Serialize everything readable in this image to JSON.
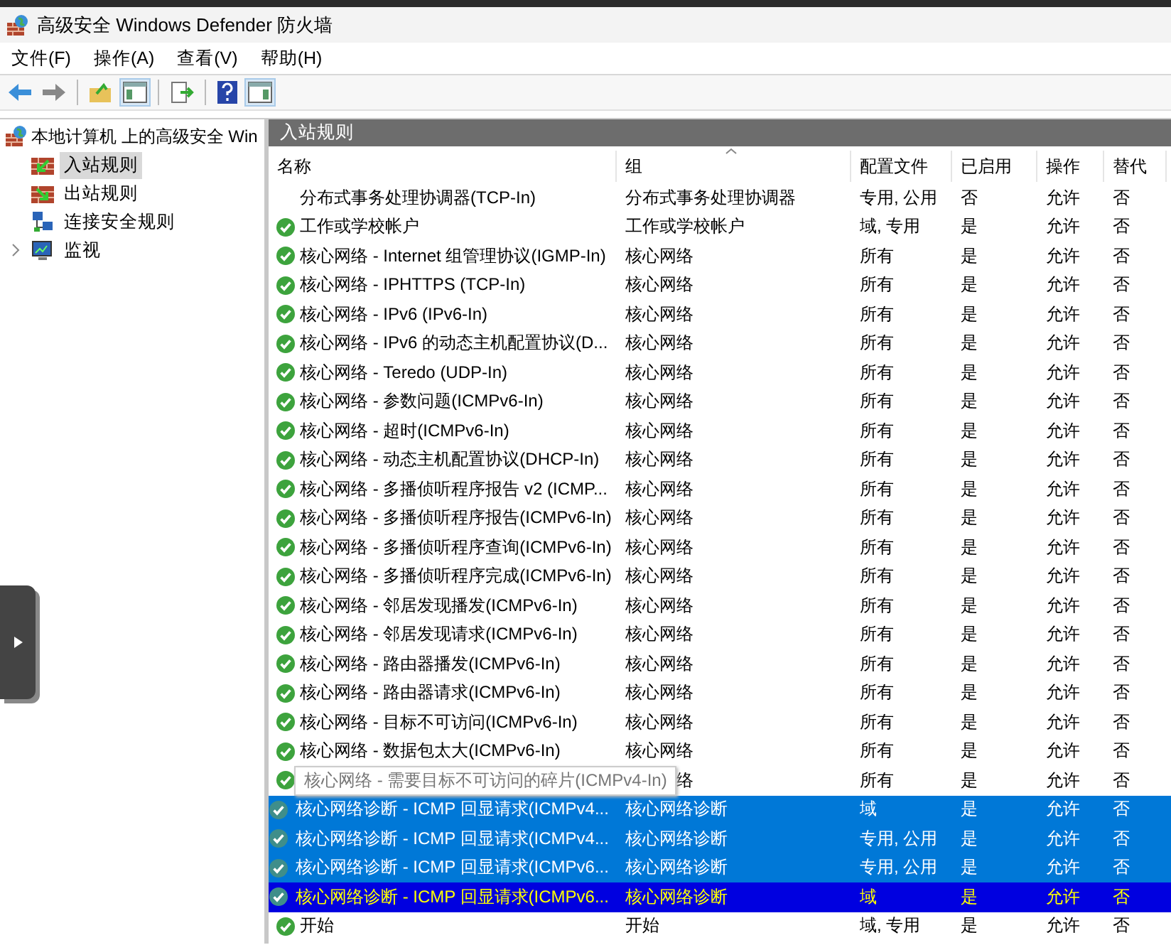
{
  "window": {
    "title": "高级安全 Windows Defender 防火墙"
  },
  "menu": [
    "文件(F)",
    "操作(A)",
    "查看(V)",
    "帮助(H)"
  ],
  "tree": {
    "root": "本地计算机 上的高级安全 Win",
    "items": [
      {
        "label": "入站规则",
        "selected": true,
        "kind": "inbound"
      },
      {
        "label": "出站规则",
        "selected": false,
        "kind": "outbound"
      },
      {
        "label": "连接安全规则",
        "selected": false,
        "kind": "connection"
      },
      {
        "label": "监视",
        "selected": false,
        "kind": "monitor",
        "expandable": true
      }
    ]
  },
  "panel": {
    "title": "入站规则"
  },
  "table": {
    "columns": [
      "名称",
      "组",
      "配置文件",
      "已启用",
      "操作",
      "替代"
    ],
    "rows": [
      {
        "name": "分布式事务处理协调器(TCP-In)",
        "group": "分布式事务处理协调器",
        "profile": "专用, 公用",
        "enabled": "否",
        "action": "允许",
        "override": "否",
        "active": false,
        "selected": false,
        "focused": false
      },
      {
        "name": "工作或学校帐户",
        "group": "工作或学校帐户",
        "profile": "域, 专用",
        "enabled": "是",
        "action": "允许",
        "override": "否",
        "active": true,
        "selected": false,
        "focused": false
      },
      {
        "name": "核心网络 - Internet 组管理协议(IGMP-In)",
        "group": "核心网络",
        "profile": "所有",
        "enabled": "是",
        "action": "允许",
        "override": "否",
        "active": true,
        "selected": false,
        "focused": false
      },
      {
        "name": "核心网络 - IPHTTPS (TCP-In)",
        "group": "核心网络",
        "profile": "所有",
        "enabled": "是",
        "action": "允许",
        "override": "否",
        "active": true,
        "selected": false,
        "focused": false
      },
      {
        "name": "核心网络 - IPv6 (IPv6-In)",
        "group": "核心网络",
        "profile": "所有",
        "enabled": "是",
        "action": "允许",
        "override": "否",
        "active": true,
        "selected": false,
        "focused": false
      },
      {
        "name": "核心网络 - IPv6 的动态主机配置协议(D...",
        "group": "核心网络",
        "profile": "所有",
        "enabled": "是",
        "action": "允许",
        "override": "否",
        "active": true,
        "selected": false,
        "focused": false
      },
      {
        "name": "核心网络 - Teredo (UDP-In)",
        "group": "核心网络",
        "profile": "所有",
        "enabled": "是",
        "action": "允许",
        "override": "否",
        "active": true,
        "selected": false,
        "focused": false
      },
      {
        "name": "核心网络 - 参数问题(ICMPv6-In)",
        "group": "核心网络",
        "profile": "所有",
        "enabled": "是",
        "action": "允许",
        "override": "否",
        "active": true,
        "selected": false,
        "focused": false
      },
      {
        "name": "核心网络 - 超时(ICMPv6-In)",
        "group": "核心网络",
        "profile": "所有",
        "enabled": "是",
        "action": "允许",
        "override": "否",
        "active": true,
        "selected": false,
        "focused": false
      },
      {
        "name": "核心网络 - 动态主机配置协议(DHCP-In)",
        "group": "核心网络",
        "profile": "所有",
        "enabled": "是",
        "action": "允许",
        "override": "否",
        "active": true,
        "selected": false,
        "focused": false
      },
      {
        "name": "核心网络 - 多播侦听程序报告 v2 (ICMP...",
        "group": "核心网络",
        "profile": "所有",
        "enabled": "是",
        "action": "允许",
        "override": "否",
        "active": true,
        "selected": false,
        "focused": false
      },
      {
        "name": "核心网络 - 多播侦听程序报告(ICMPv6-In)",
        "group": "核心网络",
        "profile": "所有",
        "enabled": "是",
        "action": "允许",
        "override": "否",
        "active": true,
        "selected": false,
        "focused": false
      },
      {
        "name": "核心网络 - 多播侦听程序查询(ICMPv6-In)",
        "group": "核心网络",
        "profile": "所有",
        "enabled": "是",
        "action": "允许",
        "override": "否",
        "active": true,
        "selected": false,
        "focused": false
      },
      {
        "name": "核心网络 - 多播侦听程序完成(ICMPv6-In)",
        "group": "核心网络",
        "profile": "所有",
        "enabled": "是",
        "action": "允许",
        "override": "否",
        "active": true,
        "selected": false,
        "focused": false
      },
      {
        "name": "核心网络 - 邻居发现播发(ICMPv6-In)",
        "group": "核心网络",
        "profile": "所有",
        "enabled": "是",
        "action": "允许",
        "override": "否",
        "active": true,
        "selected": false,
        "focused": false
      },
      {
        "name": "核心网络 - 邻居发现请求(ICMPv6-In)",
        "group": "核心网络",
        "profile": "所有",
        "enabled": "是",
        "action": "允许",
        "override": "否",
        "active": true,
        "selected": false,
        "focused": false
      },
      {
        "name": "核心网络 - 路由器播发(ICMPv6-In)",
        "group": "核心网络",
        "profile": "所有",
        "enabled": "是",
        "action": "允许",
        "override": "否",
        "active": true,
        "selected": false,
        "focused": false
      },
      {
        "name": "核心网络 - 路由器请求(ICMPv6-In)",
        "group": "核心网络",
        "profile": "所有",
        "enabled": "是",
        "action": "允许",
        "override": "否",
        "active": true,
        "selected": false,
        "focused": false
      },
      {
        "name": "核心网络 - 目标不可访问(ICMPv6-In)",
        "group": "核心网络",
        "profile": "所有",
        "enabled": "是",
        "action": "允许",
        "override": "否",
        "active": true,
        "selected": false,
        "focused": false
      },
      {
        "name": "核心网络 - 数据包太大(ICMPv6-In)",
        "group": "核心网络",
        "profile": "所有",
        "enabled": "是",
        "action": "允许",
        "override": "否",
        "active": true,
        "selected": false,
        "focused": false
      },
      {
        "tooltip": "核心网络 - 需要目标不可访问的碎片(ICMPv4-In)",
        "group": "络",
        "profile": "所有",
        "enabled": "是",
        "action": "允许",
        "override": "否",
        "active": true,
        "selected": false,
        "focused": false
      },
      {
        "name": "核心网络诊断 - ICMP 回显请求(ICMPv4...",
        "group": "核心网络诊断",
        "profile": "域",
        "enabled": "是",
        "action": "允许",
        "override": "否",
        "active": true,
        "selected": true,
        "focused": false
      },
      {
        "name": "核心网络诊断 - ICMP 回显请求(ICMPv4...",
        "group": "核心网络诊断",
        "profile": "专用, 公用",
        "enabled": "是",
        "action": "允许",
        "override": "否",
        "active": true,
        "selected": true,
        "focused": false
      },
      {
        "name": "核心网络诊断 - ICMP 回显请求(ICMPv6...",
        "group": "核心网络诊断",
        "profile": "专用, 公用",
        "enabled": "是",
        "action": "允许",
        "override": "否",
        "active": true,
        "selected": true,
        "focused": false
      },
      {
        "name": "核心网络诊断 - ICMP 回显请求(ICMPv6...",
        "group": "核心网络诊断",
        "profile": "域",
        "enabled": "是",
        "action": "允许",
        "override": "否",
        "active": true,
        "selected": true,
        "focused": true
      },
      {
        "name": "开始",
        "group": "开始",
        "profile": "域, 专用",
        "enabled": "是",
        "action": "允许",
        "override": "否",
        "active": true,
        "selected": false,
        "focused": false
      }
    ]
  }
}
